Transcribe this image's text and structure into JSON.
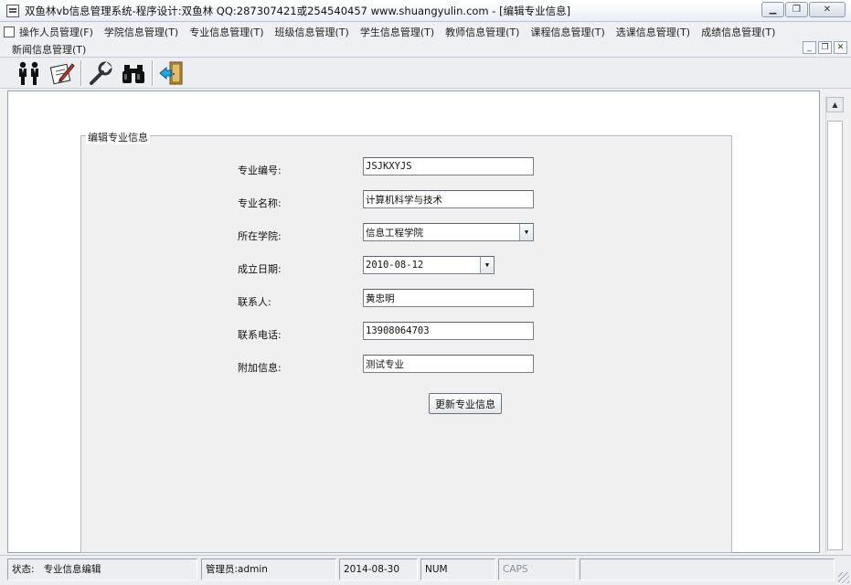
{
  "window": {
    "title": "双鱼林vb信息管理系统-程序设计:双鱼林 QQ:287307421或254540457 www.shuangyulin.com - [编辑专业信息]",
    "controls": [
      "minimize-icon",
      "restore-icon",
      "close-icon"
    ]
  },
  "menu": {
    "row1": [
      "操作人员管理(F)",
      "学院信息管理(T)",
      "专业信息管理(T)",
      "班级信息管理(T)",
      "学生信息管理(T)",
      "教师信息管理(T)",
      "课程信息管理(T)",
      "选课信息管理(T)",
      "成绩信息管理(T)"
    ],
    "row2": [
      "新闻信息管理(T)"
    ]
  },
  "toolbar": {
    "buttons": [
      "users-icon",
      "edit-paper-icon",
      "tools-icon",
      "binoculars-icon",
      "exit-door-icon"
    ]
  },
  "form": {
    "legend": "编辑专业信息",
    "fields": [
      {
        "label": "专业编号:",
        "value": "JSJKXYJS"
      },
      {
        "label": "专业名称:",
        "value": "计算机科学与技术"
      },
      {
        "label": "所在学院:",
        "value": "信息工程学院"
      },
      {
        "label": "成立日期:",
        "value": "2010-08-12"
      },
      {
        "label": "联系人:",
        "value": "黄忠明"
      },
      {
        "label": "联系电话:",
        "value": "13908064703"
      },
      {
        "label": "附加信息:",
        "value": "测试专业"
      }
    ],
    "submit_label": "更新专业信息"
  },
  "status": {
    "label": "状态:",
    "state": "专业信息编辑",
    "admin": "管理员:admin",
    "date": "2014-08-30",
    "num": "NUM",
    "caps": "CAPS",
    "empty": ""
  }
}
